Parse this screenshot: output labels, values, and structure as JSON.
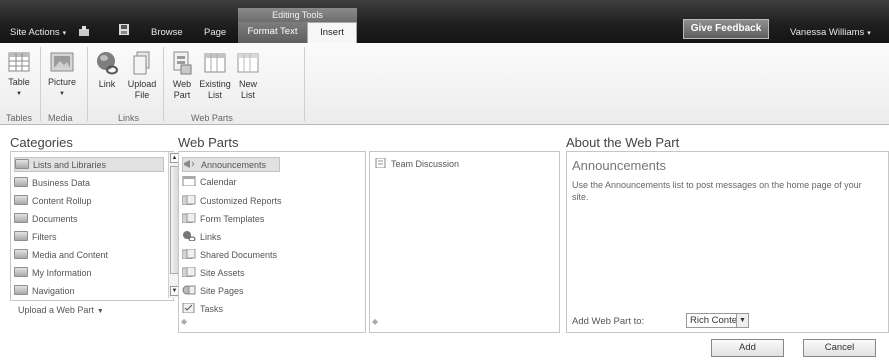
{
  "topbar": {
    "site_actions": "Site Actions",
    "tabs": [
      "Browse",
      "Page"
    ],
    "tool_group": "Editing Tools",
    "contextual_tabs": [
      "Format Text",
      "Insert"
    ],
    "give_feedback": "Give Feedback",
    "user": "Vanessa Williams"
  },
  "ribbon": {
    "groups": [
      {
        "label": "Tables",
        "buttons": [
          {
            "line1": "Table",
            "line2": "",
            "icon": "table-icon"
          }
        ]
      },
      {
        "label": "Media",
        "buttons": [
          {
            "line1": "Picture",
            "line2": "",
            "icon": "picture-icon"
          }
        ]
      },
      {
        "label": "Links",
        "buttons": [
          {
            "line1": "Link",
            "line2": "",
            "icon": "link-icon"
          },
          {
            "line1": "Upload",
            "line2": "File",
            "icon": "upload-file-icon"
          }
        ]
      },
      {
        "label": "Web Parts",
        "buttons": [
          {
            "line1": "Web",
            "line2": "Part",
            "icon": "web-part-icon"
          },
          {
            "line1": "Existing",
            "line2": "List",
            "icon": "existing-list-icon"
          },
          {
            "line1": "New",
            "line2": "List",
            "icon": "new-list-icon"
          }
        ]
      }
    ]
  },
  "categories": {
    "title": "Categories",
    "items": [
      "Lists and Libraries",
      "Business Data",
      "Content Rollup",
      "Documents",
      "Filters",
      "Media and Content",
      "My Information",
      "Navigation"
    ],
    "selected": "Lists and Libraries",
    "upload": "Upload a Web Part"
  },
  "webparts": {
    "title": "Web Parts",
    "items": [
      {
        "label": "Announcements",
        "icon": "announcements-icon"
      },
      {
        "label": "Calendar",
        "icon": "calendar-icon"
      },
      {
        "label": "Customized Reports",
        "icon": "document-library-icon"
      },
      {
        "label": "Form Templates",
        "icon": "document-library-icon"
      },
      {
        "label": "Links",
        "icon": "links-icon"
      },
      {
        "label": "Shared Documents",
        "icon": "document-library-icon"
      },
      {
        "label": "Site Assets",
        "icon": "document-library-icon"
      },
      {
        "label": "Site Pages",
        "icon": "site-pages-icon"
      },
      {
        "label": "Tasks",
        "icon": "tasks-icon"
      }
    ],
    "selected": "Announcements",
    "second_column": [
      {
        "label": "Team Discussion",
        "icon": "discussion-icon"
      }
    ]
  },
  "about": {
    "title": "About the Web Part",
    "name": "Announcements",
    "description": "Use the Announcements list to post messages on the home page of your site.",
    "add_to_label": "Add Web Part to:",
    "add_to_value": "Rich Content"
  },
  "footer": {
    "add": "Add",
    "cancel": "Cancel"
  }
}
